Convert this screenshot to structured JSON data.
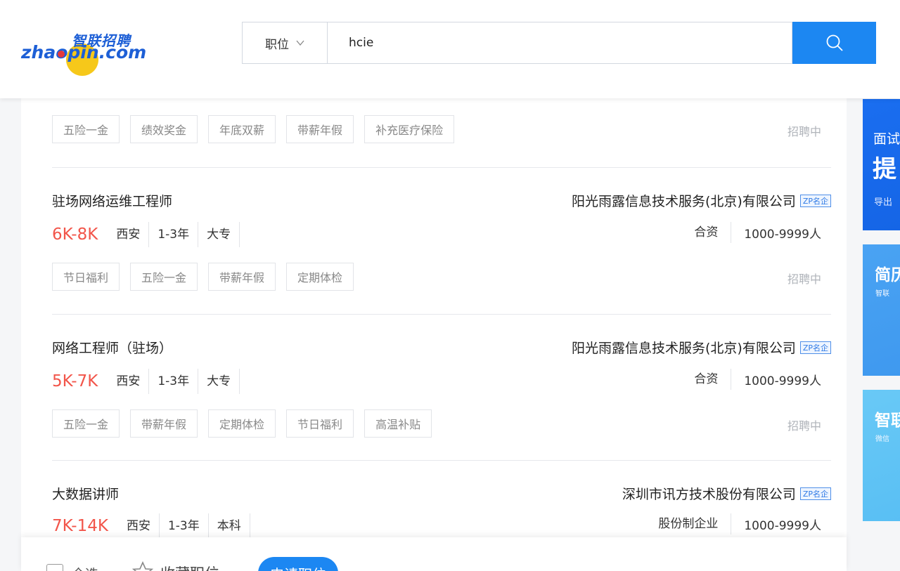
{
  "header": {
    "logo": {
      "cn": "智联招聘",
      "en": "zhaopin.com"
    },
    "search": {
      "type_label": "职位",
      "query": "hcie"
    }
  },
  "jobs": [
    {
      "tags": [
        "五险一金",
        "绩效奖金",
        "年底双薪",
        "带薪年假",
        "补充医疗保险"
      ],
      "status": "招聘中"
    },
    {
      "title": "驻场网络运维工程师",
      "company": "阳光雨露信息技术服务(北京)有限公司",
      "badge": "ZP名企",
      "salary": "6K-8K",
      "city": "西安",
      "experience": "1-3年",
      "education": "大专",
      "company_type": "合资",
      "company_size": "1000-9999人",
      "tags": [
        "节日福利",
        "五险一金",
        "带薪年假",
        "定期体检"
      ],
      "status": "招聘中"
    },
    {
      "title": "网络工程师（驻场）",
      "company": "阳光雨露信息技术服务(北京)有限公司",
      "badge": "ZP名企",
      "salary": "5K-7K",
      "city": "西安",
      "experience": "1-3年",
      "education": "大专",
      "company_type": "合资",
      "company_size": "1000-9999人",
      "tags": [
        "五险一金",
        "带薪年假",
        "定期体检",
        "节日福利",
        "高温补贴"
      ],
      "status": "招聘中"
    },
    {
      "title": "大数据讲师",
      "company": "深圳市讯方技术股份有限公司",
      "badge": "ZP名企",
      "salary": "7K-14K",
      "city": "西安",
      "experience": "1-3年",
      "education": "本科",
      "company_type": "股份制企业",
      "company_size": "1000-9999人"
    }
  ],
  "bottom_bar": {
    "select_all": "全选",
    "favorite": "收藏职位",
    "apply": "申请职位"
  },
  "side_ads": [
    {
      "line1": "面试",
      "line2": "提",
      "line3": "导出"
    },
    {
      "title": "简历",
      "subtitle": "智联"
    },
    {
      "title": "智联",
      "subtitle": "微信"
    }
  ],
  "colors": {
    "accent": "#1c87f2",
    "salary": "#f2554a",
    "brand": "#1d5fd6"
  }
}
